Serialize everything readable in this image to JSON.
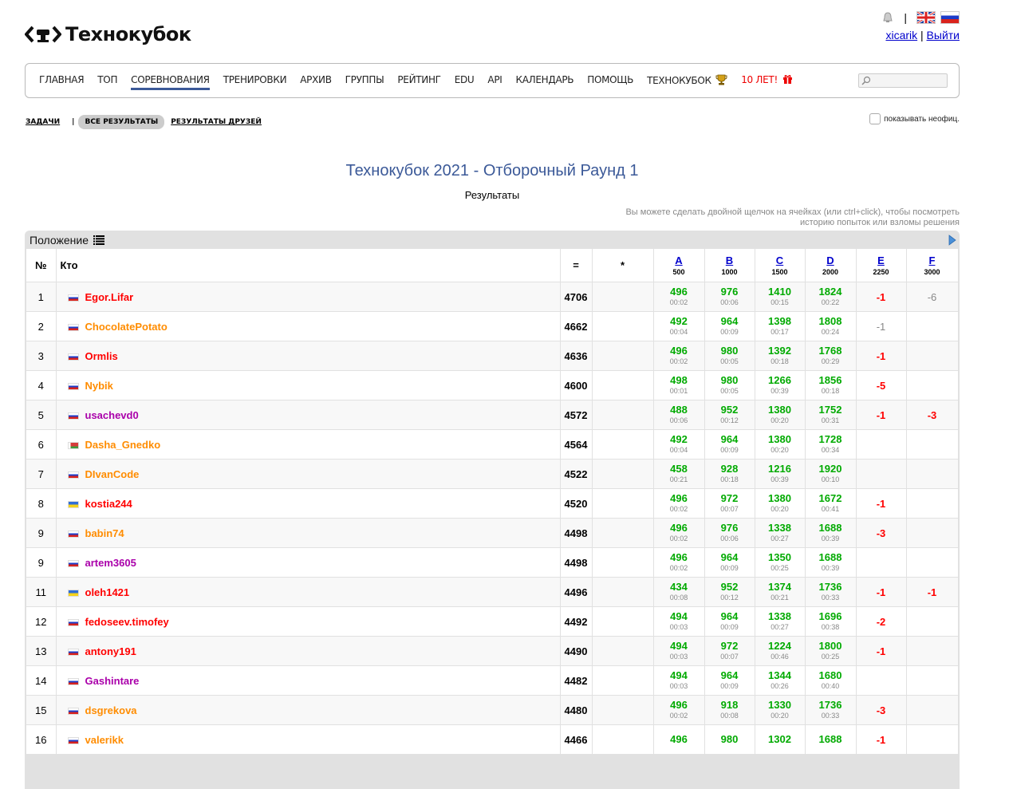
{
  "header": {
    "brand": "Технокубок",
    "user": "xicarik",
    "separator": "|",
    "logout": "Выйти"
  },
  "menu": {
    "items": [
      "Главная",
      "Топ",
      "Соревнования",
      "Тренировки",
      "Архив",
      "Группы",
      "Рейтинг",
      "Edu",
      "API",
      "Календарь",
      "Помощь",
      "Технокубок",
      "10 лет!"
    ],
    "active": "Соревнования"
  },
  "tabs": {
    "problems": "ЗАДАЧИ",
    "sep": "|",
    "all_results": "ВСЕ РЕЗУЛЬТАТЫ",
    "friends_results": "РЕЗУЛЬТАТЫ ДРУЗЕЙ"
  },
  "show_unofficial": "показывать неофиц.",
  "contest": {
    "title": "Технокубок 2021 - Отборочный Раунд 1",
    "subtitle": "Результаты"
  },
  "hint": "Вы можете сделать двойной щелчок на ячейках (или ctrl+click), чтобы посмотреть историю попыток или взломы решения",
  "standings": {
    "label": "Положение",
    "columns": {
      "rank": "№",
      "who": "Кто",
      "points": "=",
      "hacks": "*"
    },
    "problems": [
      {
        "letter": "A",
        "score": "500"
      },
      {
        "letter": "B",
        "score": "1000"
      },
      {
        "letter": "C",
        "score": "1500"
      },
      {
        "letter": "D",
        "score": "2000"
      },
      {
        "letter": "E",
        "score": "2250"
      },
      {
        "letter": "F",
        "score": "3000"
      }
    ],
    "rows": [
      {
        "rank": "1",
        "country": "ru",
        "handle": "Egor.Lifar",
        "color": "red",
        "points": "4706",
        "hacks": "",
        "cells": [
          [
            "496",
            "00:02"
          ],
          [
            "976",
            "00:06"
          ],
          [
            "1410",
            "00:15"
          ],
          [
            "1824",
            "00:22"
          ],
          [
            "-1",
            ""
          ],
          [
            "-6",
            "gray"
          ]
        ]
      },
      {
        "rank": "2",
        "country": "ru",
        "handle": "ChocolatePotato",
        "color": "orange",
        "points": "4662",
        "hacks": "",
        "cells": [
          [
            "492",
            "00:04"
          ],
          [
            "964",
            "00:09"
          ],
          [
            "1398",
            "00:17"
          ],
          [
            "1808",
            "00:24"
          ],
          [
            "-1",
            "gray"
          ],
          [
            "",
            ""
          ]
        ]
      },
      {
        "rank": "3",
        "country": "ru",
        "handle": "Ormlis",
        "color": "red",
        "points": "4636",
        "hacks": "",
        "cells": [
          [
            "496",
            "00:02"
          ],
          [
            "980",
            "00:05"
          ],
          [
            "1392",
            "00:18"
          ],
          [
            "1768",
            "00:29"
          ],
          [
            "-1",
            ""
          ],
          [
            "",
            ""
          ]
        ]
      },
      {
        "rank": "4",
        "country": "ru",
        "handle": "Nybik",
        "color": "orange",
        "points": "4600",
        "hacks": "",
        "cells": [
          [
            "498",
            "00:01"
          ],
          [
            "980",
            "00:05"
          ],
          [
            "1266",
            "00:39"
          ],
          [
            "1856",
            "00:18"
          ],
          [
            "-5",
            ""
          ],
          [
            "",
            ""
          ]
        ]
      },
      {
        "rank": "5",
        "country": "ru",
        "handle": "usachevd0",
        "color": "violet",
        "points": "4572",
        "hacks": "",
        "cells": [
          [
            "488",
            "00:06"
          ],
          [
            "952",
            "00:12"
          ],
          [
            "1380",
            "00:20"
          ],
          [
            "1752",
            "00:31"
          ],
          [
            "-1",
            ""
          ],
          [
            "-3",
            ""
          ]
        ]
      },
      {
        "rank": "6",
        "country": "by",
        "handle": "Dasha_Gnedko",
        "color": "orange",
        "points": "4564",
        "hacks": "",
        "cells": [
          [
            "492",
            "00:04"
          ],
          [
            "964",
            "00:09"
          ],
          [
            "1380",
            "00:20"
          ],
          [
            "1728",
            "00:34"
          ],
          [
            "",
            ""
          ],
          [
            "",
            ""
          ]
        ]
      },
      {
        "rank": "7",
        "country": "ru",
        "handle": "DIvanCode",
        "color": "orange",
        "points": "4522",
        "hacks": "",
        "cells": [
          [
            "458",
            "00:21"
          ],
          [
            "928",
            "00:18"
          ],
          [
            "1216",
            "00:39"
          ],
          [
            "1920",
            "00:10"
          ],
          [
            "",
            ""
          ],
          [
            "",
            ""
          ]
        ]
      },
      {
        "rank": "8",
        "country": "ua",
        "handle": "kostia244",
        "color": "red",
        "points": "4520",
        "hacks": "",
        "cells": [
          [
            "496",
            "00:02"
          ],
          [
            "972",
            "00:07"
          ],
          [
            "1380",
            "00:20"
          ],
          [
            "1672",
            "00:41"
          ],
          [
            "-1",
            ""
          ],
          [
            "",
            ""
          ]
        ]
      },
      {
        "rank": "9",
        "country": "ru",
        "handle": "babin74",
        "color": "orange",
        "points": "4498",
        "hacks": "",
        "cells": [
          [
            "496",
            "00:02"
          ],
          [
            "976",
            "00:06"
          ],
          [
            "1338",
            "00:27"
          ],
          [
            "1688",
            "00:39"
          ],
          [
            "-3",
            ""
          ],
          [
            "",
            ""
          ]
        ]
      },
      {
        "rank": "9",
        "country": "ru",
        "handle": "artem3605",
        "color": "violet",
        "points": "4498",
        "hacks": "",
        "cells": [
          [
            "496",
            "00:02"
          ],
          [
            "964",
            "00:09"
          ],
          [
            "1350",
            "00:25"
          ],
          [
            "1688",
            "00:39"
          ],
          [
            "",
            ""
          ],
          [
            "",
            ""
          ]
        ]
      },
      {
        "rank": "11",
        "country": "ua",
        "handle": "oleh1421",
        "color": "red",
        "points": "4496",
        "hacks": "",
        "cells": [
          [
            "434",
            "00:08"
          ],
          [
            "952",
            "00:12"
          ],
          [
            "1374",
            "00:21"
          ],
          [
            "1736",
            "00:33"
          ],
          [
            "-1",
            ""
          ],
          [
            "-1",
            ""
          ]
        ]
      },
      {
        "rank": "12",
        "country": "ru",
        "handle": "fedoseev.timofey",
        "color": "red",
        "points": "4492",
        "hacks": "",
        "cells": [
          [
            "494",
            "00:03"
          ],
          [
            "964",
            "00:09"
          ],
          [
            "1338",
            "00:27"
          ],
          [
            "1696",
            "00:38"
          ],
          [
            "-2",
            ""
          ],
          [
            "",
            ""
          ]
        ]
      },
      {
        "rank": "13",
        "country": "ru",
        "handle": "antony191",
        "color": "red",
        "points": "4490",
        "hacks": "",
        "cells": [
          [
            "494",
            "00:03"
          ],
          [
            "972",
            "00:07"
          ],
          [
            "1224",
            "00:46"
          ],
          [
            "1800",
            "00:25"
          ],
          [
            "-1",
            ""
          ],
          [
            "",
            ""
          ]
        ]
      },
      {
        "rank": "14",
        "country": "ru",
        "handle": "Gashintare",
        "color": "violet",
        "points": "4482",
        "hacks": "",
        "cells": [
          [
            "494",
            "00:03"
          ],
          [
            "964",
            "00:09"
          ],
          [
            "1344",
            "00:26"
          ],
          [
            "1680",
            "00:40"
          ],
          [
            "",
            ""
          ],
          [
            "",
            ""
          ]
        ]
      },
      {
        "rank": "15",
        "country": "ru",
        "handle": "dsgrekova",
        "color": "orange",
        "points": "4480",
        "hacks": "",
        "cells": [
          [
            "496",
            "00:02"
          ],
          [
            "918",
            "00:08"
          ],
          [
            "1330",
            "00:20"
          ],
          [
            "1736",
            "00:33"
          ],
          [
            "-3",
            ""
          ],
          [
            "",
            ""
          ]
        ]
      },
      {
        "rank": "16",
        "country": "ru",
        "handle": "valerikk",
        "color": "orange",
        "points": "4466",
        "hacks": "",
        "cells": [
          [
            "496",
            ""
          ],
          [
            "980",
            ""
          ],
          [
            "1302",
            ""
          ],
          [
            "1688",
            ""
          ],
          [
            "-1",
            ""
          ],
          [
            "",
            ""
          ]
        ]
      }
    ]
  }
}
